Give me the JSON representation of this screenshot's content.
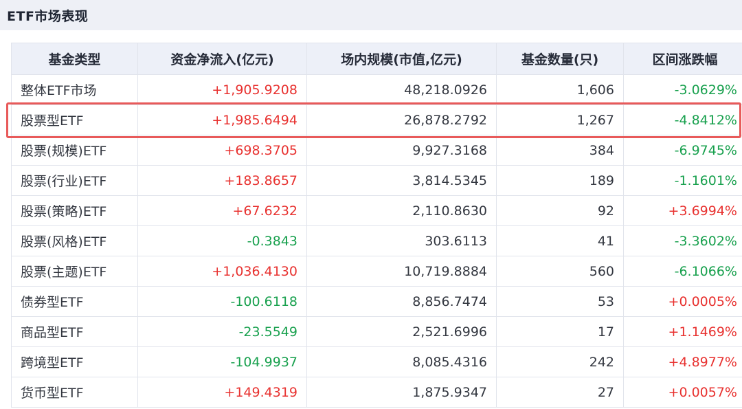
{
  "panel": {
    "title": "ETF市场表现"
  },
  "table": {
    "headers": [
      "基金类型",
      "资金净流入(亿元)",
      "场内规模(市值,亿元)",
      "基金数量(只)",
      "区间涨跌幅"
    ],
    "rows": [
      [
        "整体ETF市场",
        "+1,905.9208",
        "48,218.0926",
        "1,606",
        "-3.0629%"
      ],
      [
        "股票型ETF",
        "+1,985.6494",
        "26,878.2792",
        "1,267",
        "-4.8412%"
      ],
      [
        "股票(规模)ETF",
        "+698.3705",
        "9,927.3168",
        "384",
        "-6.9745%"
      ],
      [
        "股票(行业)ETF",
        "+183.8657",
        "3,814.5345",
        "189",
        "-1.1601%"
      ],
      [
        "股票(策略)ETF",
        "+67.6232",
        "2,110.8630",
        "92",
        "+3.6994%"
      ],
      [
        "股票(风格)ETF",
        "-0.3843",
        "303.6113",
        "41",
        "-3.3602%"
      ],
      [
        "股票(主题)ETF",
        "+1,036.4130",
        "10,719.8884",
        "560",
        "-6.1066%"
      ],
      [
        "债券型ETF",
        "-100.6118",
        "8,856.7474",
        "53",
        "+0.0005%"
      ],
      [
        "商品型ETF",
        "-23.5549",
        "2,521.6996",
        "17",
        "+1.1469%"
      ],
      [
        "跨境型ETF",
        "-104.9937",
        "8,085.4316",
        "242",
        "+4.8977%"
      ],
      [
        "货币型ETF",
        "+149.4319",
        "1,875.9347",
        "27",
        "+0.0057%"
      ]
    ],
    "highlighted_row_index": 1
  },
  "colors": {
    "positive": "#e8312f",
    "negative": "#17a04d",
    "highlight_border": "#e85a5a",
    "header_bg": "#edf0f8"
  }
}
